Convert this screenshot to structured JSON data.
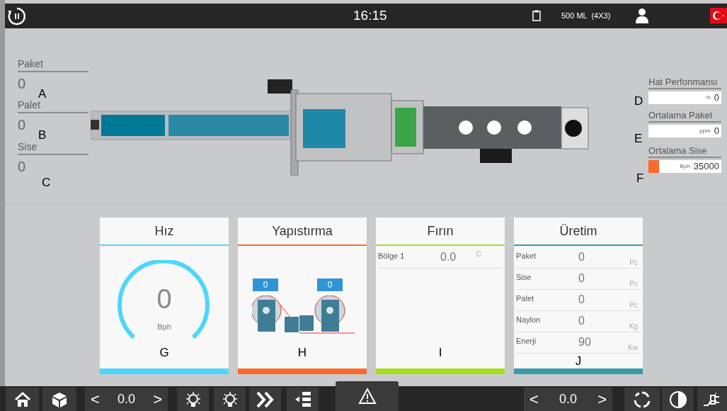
{
  "header": {
    "clock": "16:15",
    "product": "500 ML  (4X3)"
  },
  "counters": [
    {
      "label": "Paket",
      "value": "0",
      "marker": "A"
    },
    {
      "label": "Palet",
      "value": "0",
      "marker": "B"
    },
    {
      "label": "Sise",
      "value": "0",
      "marker": "C"
    }
  ],
  "metrics": [
    {
      "label": "Hat Perfonmansı",
      "unit": "%",
      "value": "0",
      "marker": "D"
    },
    {
      "label": "Ortalama Paket",
      "unit": "ppm",
      "value": "0",
      "marker": "E"
    },
    {
      "label": "Ortalama Sise",
      "unit": "Bph",
      "value": "35000",
      "marker": "F",
      "level": 0.15
    }
  ],
  "panels": [
    {
      "kind": "gauge",
      "title": "Hız",
      "color": "#4dd6fb",
      "value": "0",
      "unit": "Bph",
      "marker": "G"
    },
    {
      "kind": "glue",
      "title": "Yapıstırma",
      "color": "#fb6a2c",
      "values": [
        "0",
        "0"
      ],
      "marker": "H"
    },
    {
      "kind": "table",
      "title": "Fırın",
      "color": "#a4e01a",
      "rows": [
        {
          "label": "Bölge 1",
          "value": "0.0",
          "unit": "C"
        }
      ],
      "marker": "I"
    },
    {
      "kind": "table",
      "title": "Üretim",
      "color": "#3a9aa8",
      "rows": [
        {
          "label": "Paket",
          "value": "0",
          "unit": "Pc"
        },
        {
          "label": "Sise",
          "value": "0",
          "unit": "Pc"
        },
        {
          "label": "Palet",
          "value": "0",
          "unit": "Pc"
        },
        {
          "label": "Naylon",
          "value": "0",
          "unit": "Kg"
        },
        {
          "label": "Enerji",
          "value": "90",
          "unit": "Kw"
        }
      ],
      "marker": "J"
    }
  ],
  "footer": {
    "left_speed": {
      "decrease": "<",
      "value": "0.0",
      "increase": ">"
    },
    "right_speed": {
      "decrease": "<",
      "value": "0.0",
      "increase": ">"
    }
  }
}
